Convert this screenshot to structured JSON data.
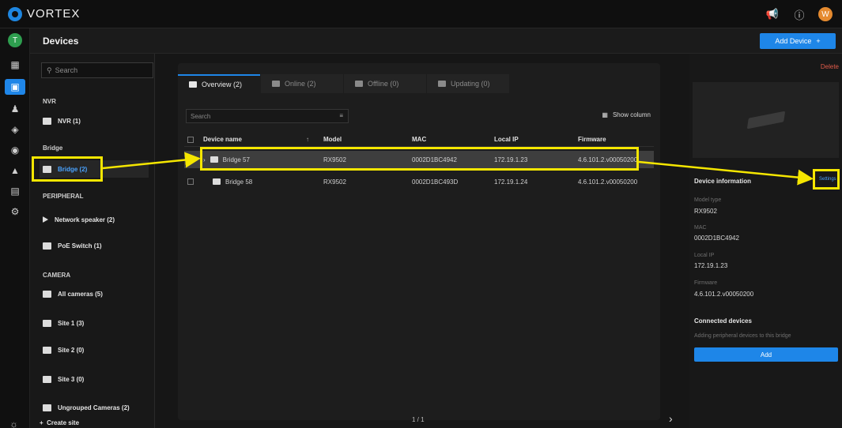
{
  "brand": {
    "name": "VORTEX"
  },
  "topbar": {
    "user_initial": "W"
  },
  "rail": {
    "avatar_initial": "T"
  },
  "header": {
    "title": "Devices",
    "add_device": "Add Device"
  },
  "sidebar": {
    "search_placeholder": "Search",
    "sections": {
      "nvr": "NVR",
      "bridge": "Bridge",
      "peripheral": "PERIPHERAL",
      "camera": "CAMERA"
    },
    "items": {
      "nvr": "NVR (1)",
      "bridge": "Bridge (2)",
      "speaker": "Network speaker (2)",
      "poe": "PoE Switch (1)",
      "all_cams": "All cameras (5)",
      "site1": "Site 1 (3)",
      "site2": "Site 2 (0)",
      "site3": "Site 3 (0)",
      "ungrouped": "Ungrouped Cameras (2)"
    },
    "create_site": "Create site"
  },
  "tabs": [
    "Overview (2)",
    "Online (2)",
    "Offline (0)",
    "Updating (0)"
  ],
  "table": {
    "search_placeholder": "Search",
    "show_column": "Show column",
    "columns": [
      "Device name",
      "Model",
      "MAC",
      "Local IP",
      "Firmware"
    ],
    "rows": [
      {
        "name": "Bridge 57",
        "model": "RX9502",
        "mac": "0002D1BC4942",
        "ip": "172.19.1.23",
        "fw": "4.6.101.2.v00050200"
      },
      {
        "name": "Bridge 58",
        "model": "RX9502",
        "mac": "0002D1BC493D",
        "ip": "172.19.1.24",
        "fw": "4.6.101.2.v00050200"
      }
    ],
    "pager": "1 / 1"
  },
  "right_panel": {
    "delete": "Delete",
    "settings": "Settings",
    "info_title": "Device information",
    "model_label": "Model type",
    "model_value": "RX9502",
    "mac_label": "MAC",
    "mac_value": "0002D1BC4942",
    "ip_label": "Local IP",
    "ip_value": "172.19.1.23",
    "fw_label": "Firmware",
    "fw_value": "4.6.101.2.v00050200",
    "connected_title": "Connected devices",
    "connected_hint": "Adding peripheral devices to this bridge",
    "add": "Add"
  },
  "colors": {
    "accent": "#1e86e8",
    "highlight": "#f5e600",
    "danger": "#e25b4a"
  }
}
